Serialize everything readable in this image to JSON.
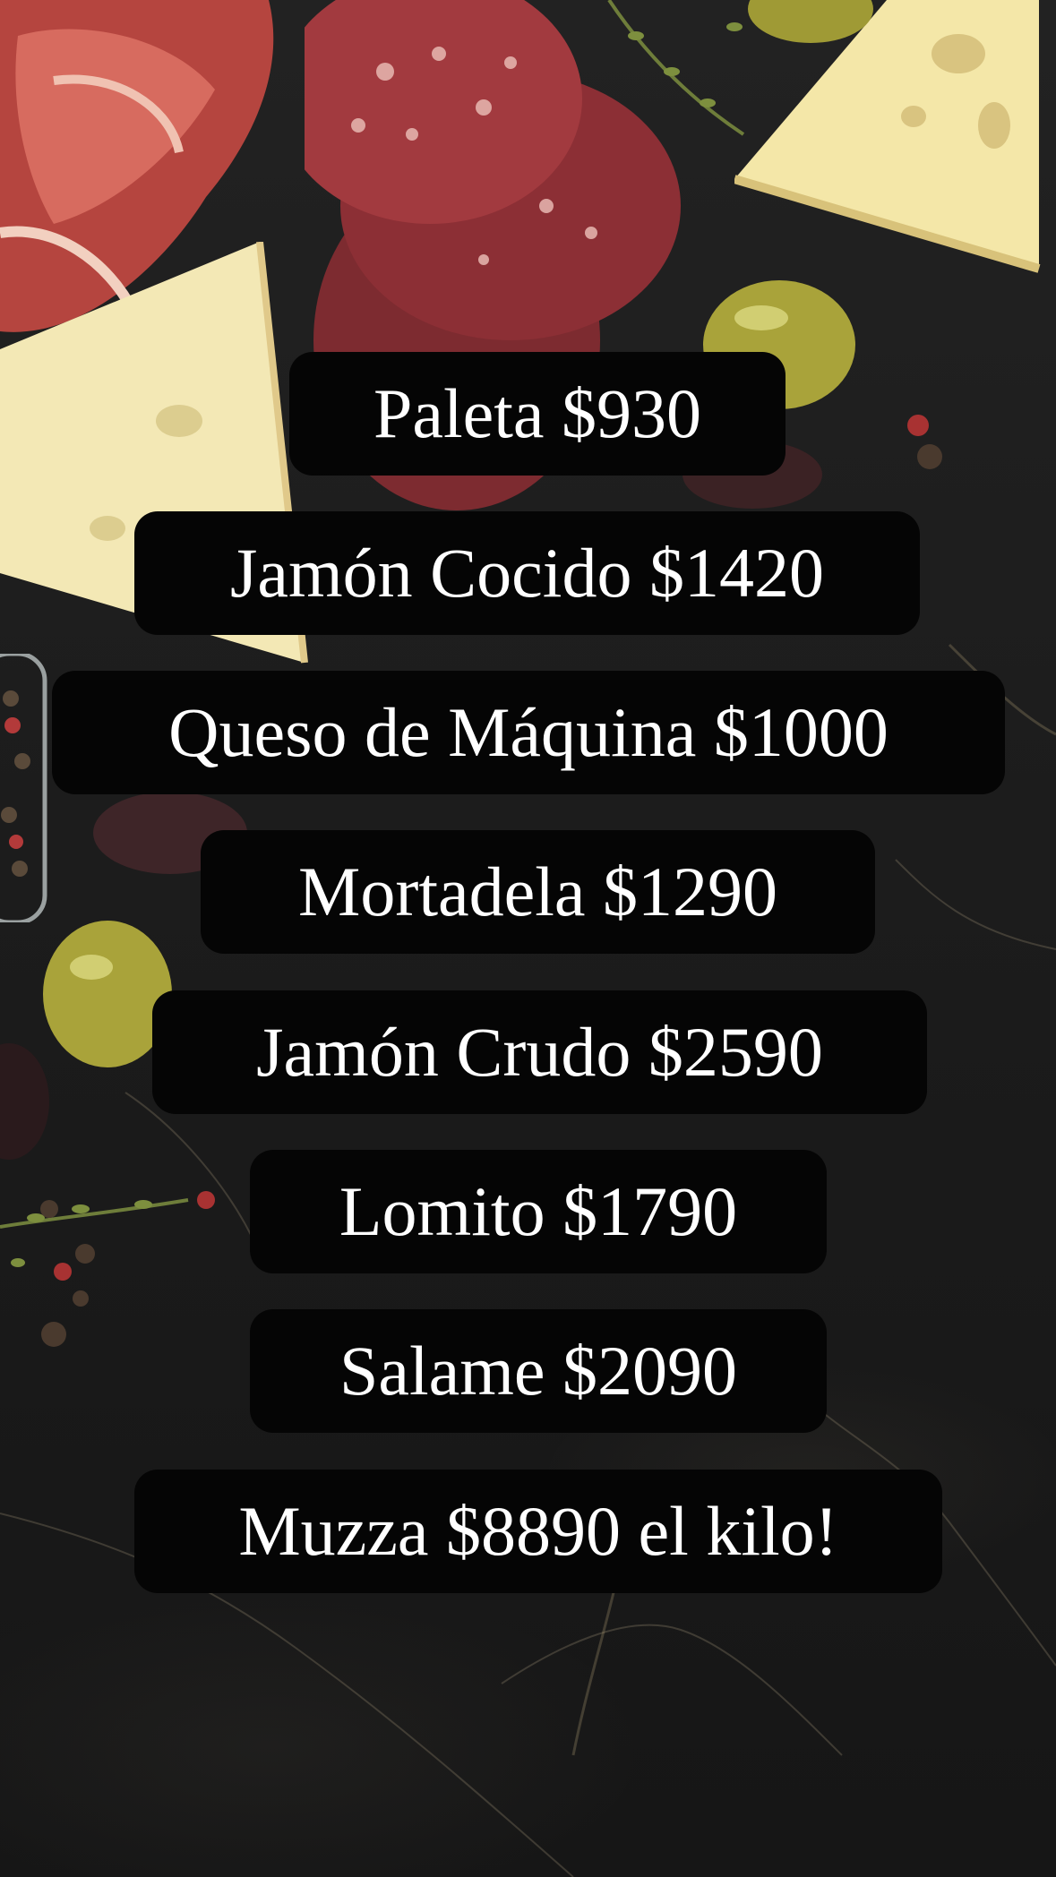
{
  "menu": {
    "items": [
      {
        "label": "Paleta $930"
      },
      {
        "label": "Jamón Cocido $1420"
      },
      {
        "label": "Queso de Máquina $1000"
      },
      {
        "label": "Mortadela $1290"
      },
      {
        "label": "Jamón Crudo $2590"
      },
      {
        "label": "Lomito $1790"
      },
      {
        "label": "Salame $2090"
      },
      {
        "label": "Muzza $8890 el kilo!"
      }
    ]
  },
  "colors": {
    "pill_background": "#050505",
    "text": "#ffffff",
    "background": "#1c1c1c"
  }
}
